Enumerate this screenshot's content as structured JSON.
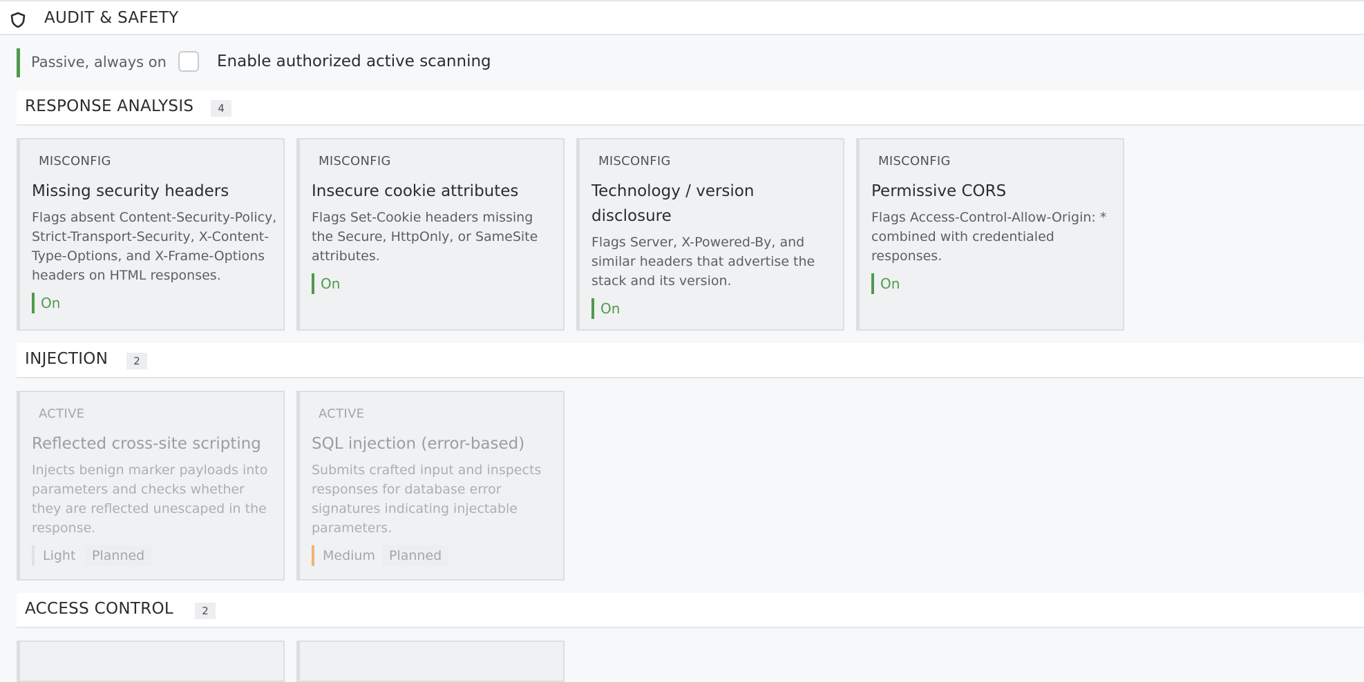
{
  "header": {
    "title": "AUDIT & SAFETY",
    "icon": "shield-icon"
  },
  "mode": {
    "passive_label": "Passive, always on",
    "active_label": "Enable authorized active scanning",
    "active_checked": false,
    "passive_color": "#4e9a4d"
  },
  "sections": [
    {
      "name": "RESPONSE ANALYSIS",
      "count": "4",
      "cards": [
        {
          "category": "MISCONFIG",
          "title": "Missing security headers",
          "description": "Flags absent Content-Security-Policy, Strict-Transport-Security, X-Content-Type-Options, and X-Frame-Options headers on HTML responses.",
          "status": "On"
        },
        {
          "category": "MISCONFIG",
          "title": "Insecure cookie attributes",
          "description": "Flags Set-Cookie headers missing the Secure, HttpOnly, or SameSite attributes.",
          "status": "On"
        },
        {
          "category": "MISCONFIG",
          "title": "Technology / version disclosure",
          "description": "Flags Server, X-Powered-By, and similar headers that advertise the stack and its version.",
          "status": "On"
        },
        {
          "category": "MISCONFIG",
          "title": "Permissive CORS",
          "description": "Flags Access-Control-Allow-Origin: * combined with credentialed responses.",
          "status": "On"
        }
      ]
    },
    {
      "name": "INJECTION",
      "count": "2",
      "cards": [
        {
          "category": "ACTIVE",
          "title": "Reflected cross-site scripting",
          "description": "Injects benign marker payloads into parameters and checks whether they are reflected unescaped in the response.",
          "severity": "Light",
          "state": "Planned"
        },
        {
          "category": "ACTIVE",
          "title": "SQL injection (error-based)",
          "description": "Submits crafted input and inspects responses for database error signatures indicating injectable parameters.",
          "severity": "Medium",
          "state": "Planned"
        }
      ]
    },
    {
      "name": "ACCESS CONTROL",
      "count": "2"
    }
  ],
  "colors": {
    "on": "#4e9a4d",
    "medium": "#f0b27a",
    "light": "#e0e2e4"
  }
}
